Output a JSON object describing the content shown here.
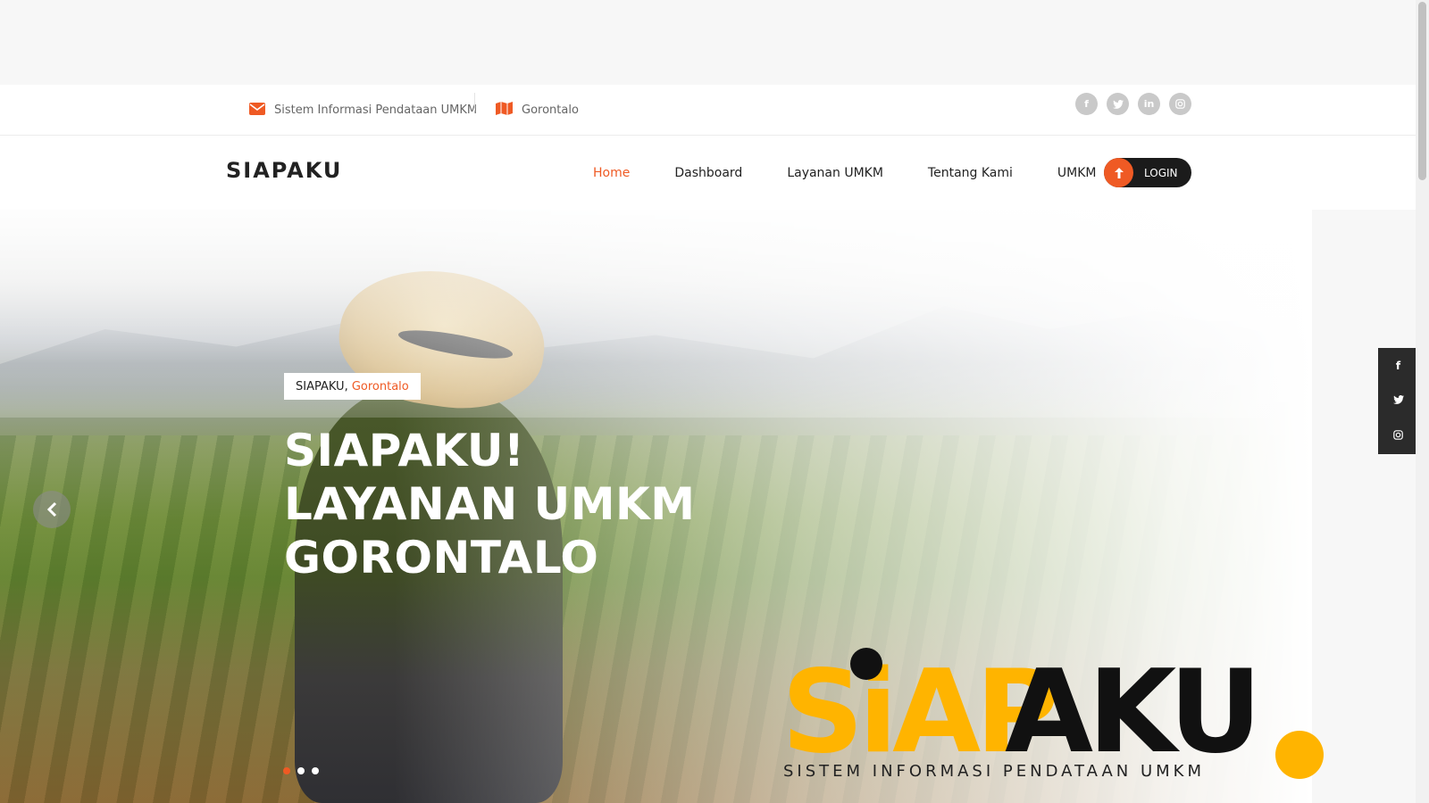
{
  "topbar": {
    "email_text": "Sistem Informasi Pendataan UMKM",
    "location_text": "Gorontalo",
    "socials": [
      "facebook-icon",
      "twitter-icon",
      "linkedin-icon",
      "instagram-icon"
    ]
  },
  "navbar": {
    "brand": "SIAPAKU",
    "menu": [
      "Home",
      "Dashboard",
      "Layanan UMKM",
      "Tentang Kami",
      "UMKM"
    ],
    "login_label": "LOGIN"
  },
  "hero": {
    "tag_prefix": "SIAPAKU,",
    "tag_accent": "Gorontalo",
    "headline_line1": "SIAPAKU!",
    "headline_line2": "LAYANAN UMKM",
    "headline_line3": "GORONTALO",
    "logo_text": "SIAPAKU",
    "logo_subtitle": "SISTEM INFORMASI PENDATAAN UMKM"
  },
  "colors": {
    "accent": "#ef5a24",
    "logo_yellow": "#ffb400",
    "dark": "#1b1b1b"
  }
}
